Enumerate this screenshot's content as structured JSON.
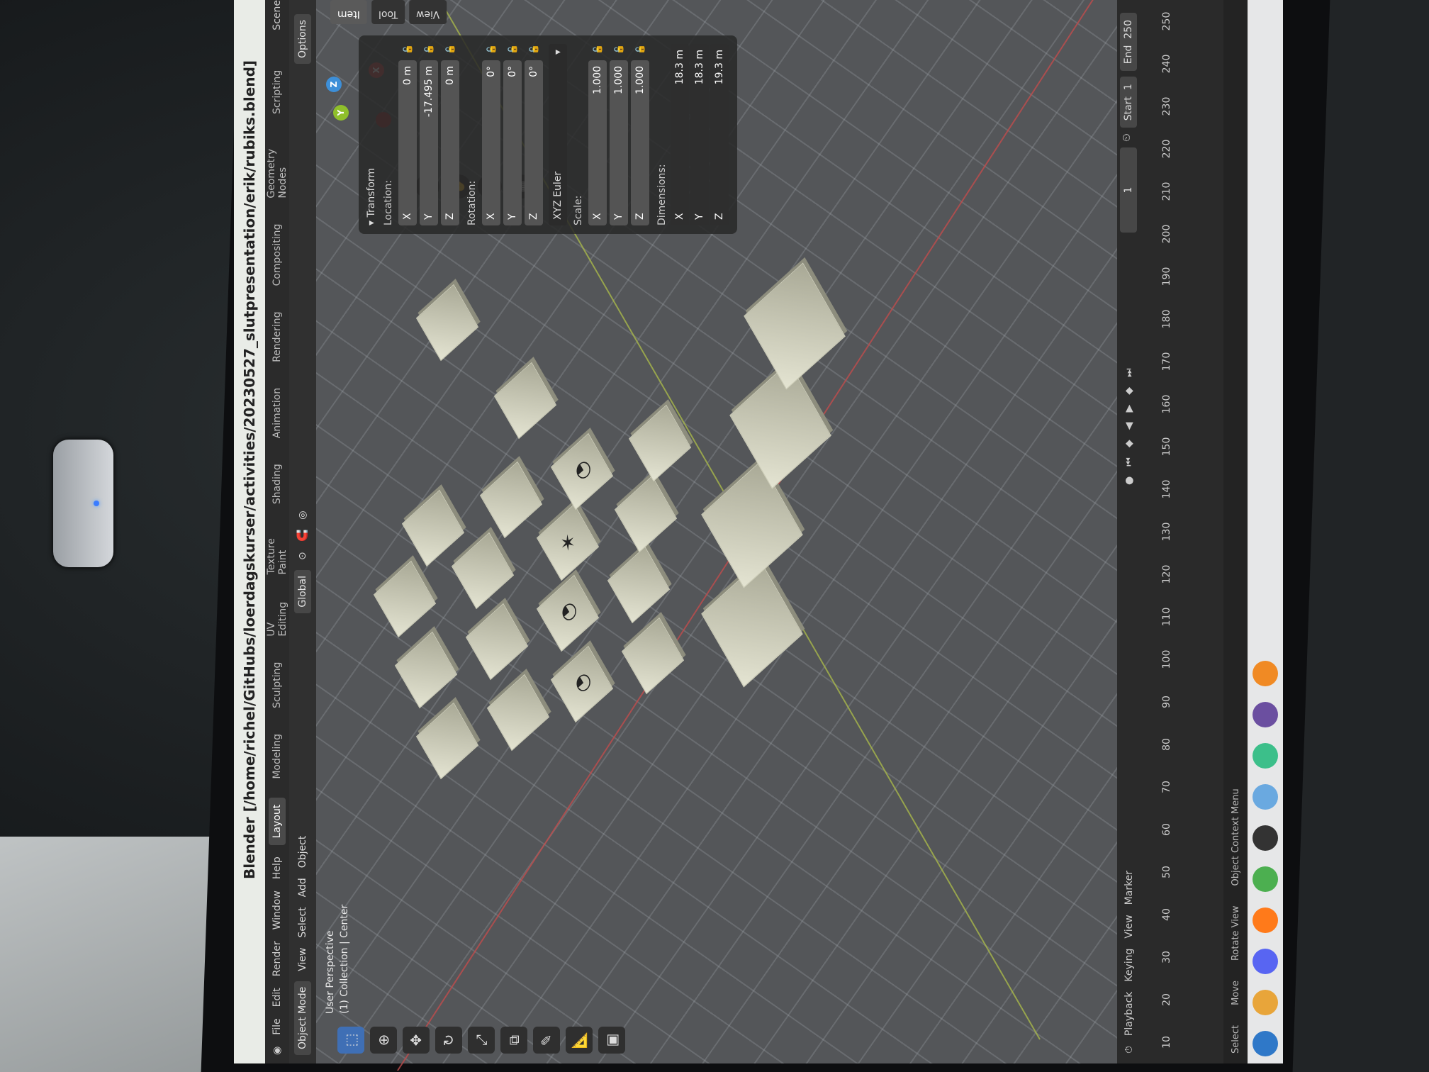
{
  "window": {
    "title": "Blender [/home/richel/GitHubs/loerdagskurser/activities/20230527_slutpresentation/erik/rubiks.blend]"
  },
  "menu": {
    "items": [
      "File",
      "Edit",
      "Render",
      "Window",
      "Help"
    ],
    "workspaces": [
      "Layout",
      "Modeling",
      "Sculpting",
      "UV Editing",
      "Texture Paint",
      "Shading",
      "Animation",
      "Rendering",
      "Compositing",
      "Geometry Nodes",
      "Scripting"
    ],
    "scene_label": "Scene"
  },
  "header": {
    "mode": "Object Mode",
    "view": "View",
    "select": "Select",
    "add": "Add",
    "object": "Object",
    "orientation": "Global",
    "options": "Options"
  },
  "viewport": {
    "perspective": "User Perspective",
    "collection": "(1) Collection | Center"
  },
  "npanel": {
    "tabs": [
      "Item",
      "Tool",
      "View"
    ],
    "transform_label": "Transform",
    "location_label": "Location:",
    "location": {
      "x": "0 m",
      "y": "-17.495 m",
      "z": "0 m"
    },
    "rotation_label": "Rotation:",
    "rotation": {
      "x": "0°",
      "y": "0°",
      "z": "0°"
    },
    "rotation_mode": "XYZ Euler",
    "scale_label": "Scale:",
    "scale": {
      "x": "1.000",
      "y": "1.000",
      "z": "1.000"
    },
    "dimensions_label": "Dimensions:",
    "dimensions": {
      "x": "18.3 m",
      "y": "18.3 m",
      "z": "19.3 m"
    },
    "axes": {
      "x": "X",
      "y": "Y",
      "z": "Z"
    }
  },
  "timeline": {
    "playback": "Playback",
    "keying": "Keying",
    "view": "View",
    "marker": "Marker",
    "current_frame": "1",
    "start_label": "Start",
    "start": "1",
    "end_label": "End",
    "end": "250",
    "ticks": [
      "10",
      "20",
      "30",
      "40",
      "50",
      "60",
      "70",
      "80",
      "90",
      "100",
      "110",
      "120",
      "130",
      "140",
      "150",
      "160",
      "170",
      "180",
      "190",
      "200",
      "210",
      "220",
      "230",
      "240",
      "250"
    ]
  },
  "status": {
    "select": "Select",
    "move": "Move",
    "rotate": "Rotate View",
    "context": "Object Context Menu"
  },
  "gizmo": {
    "x": "X",
    "y": "Y",
    "z": "Z"
  },
  "colors": {
    "x_axis": "#d24a4a",
    "y_axis": "#8fbf2b",
    "z_axis": "#3d8fd8",
    "accent": "#3f6fb5"
  }
}
